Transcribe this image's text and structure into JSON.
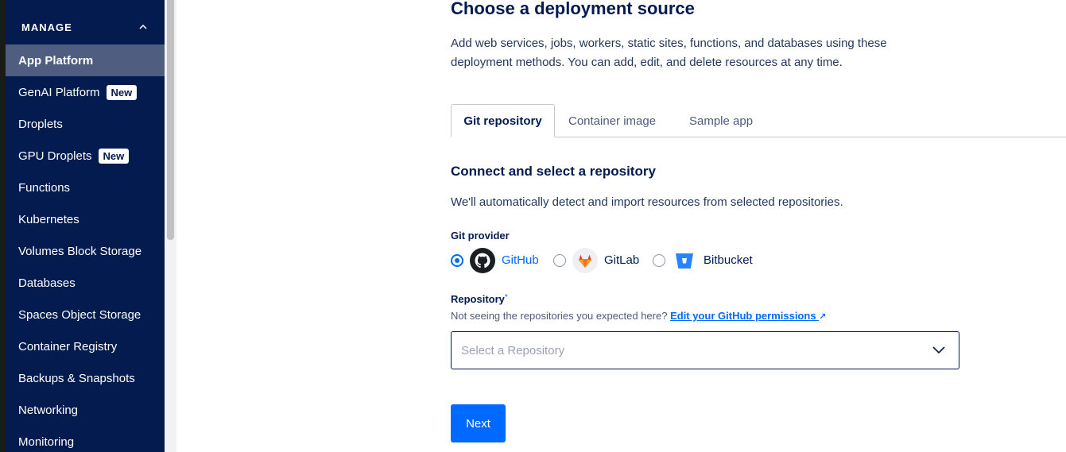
{
  "sidebar": {
    "section_label": "MANAGE",
    "items": [
      {
        "label": "App Platform",
        "badge": ""
      },
      {
        "label": "GenAI Platform",
        "badge": "New"
      },
      {
        "label": "Droplets",
        "badge": ""
      },
      {
        "label": "GPU Droplets",
        "badge": "New"
      },
      {
        "label": "Functions",
        "badge": ""
      },
      {
        "label": "Kubernetes",
        "badge": ""
      },
      {
        "label": "Volumes Block Storage",
        "badge": ""
      },
      {
        "label": "Databases",
        "badge": ""
      },
      {
        "label": "Spaces Object Storage",
        "badge": ""
      },
      {
        "label": "Container Registry",
        "badge": ""
      },
      {
        "label": "Backups & Snapshots",
        "badge": ""
      },
      {
        "label": "Networking",
        "badge": ""
      },
      {
        "label": "Monitoring",
        "badge": ""
      }
    ]
  },
  "main": {
    "title": "Choose a deployment source",
    "description": "Add web services, jobs, workers, static sites, functions, and databases using these deployment methods. You can add, edit, and delete resources at any time.",
    "tabs": [
      {
        "label": "Git repository"
      },
      {
        "label": "Container image"
      },
      {
        "label": "Sample app"
      }
    ],
    "section_title": "Connect and select a repository",
    "section_desc": "We'll automatically detect and import resources from selected repositories.",
    "git_provider_label": "Git provider",
    "providers": [
      {
        "label": "GitHub",
        "icon": "github-icon",
        "selected": true
      },
      {
        "label": "GitLab",
        "icon": "gitlab-icon",
        "selected": false
      },
      {
        "label": "Bitbucket",
        "icon": "bitbucket-icon",
        "selected": false
      }
    ],
    "repository_label": "Repository",
    "required_mark": "*",
    "hint_text": "Not seeing the repositories you expected here?",
    "hint_link": "Edit your GitHub permissions",
    "hint_link_icon": "↗",
    "select_placeholder": "Select a Repository",
    "next_label": "Next"
  },
  "colors": {
    "sidebar_bg": "#031b4e",
    "sidebar_active": "#4f5e80",
    "accent": "#0069ff",
    "text_dark": "#031b4e"
  }
}
